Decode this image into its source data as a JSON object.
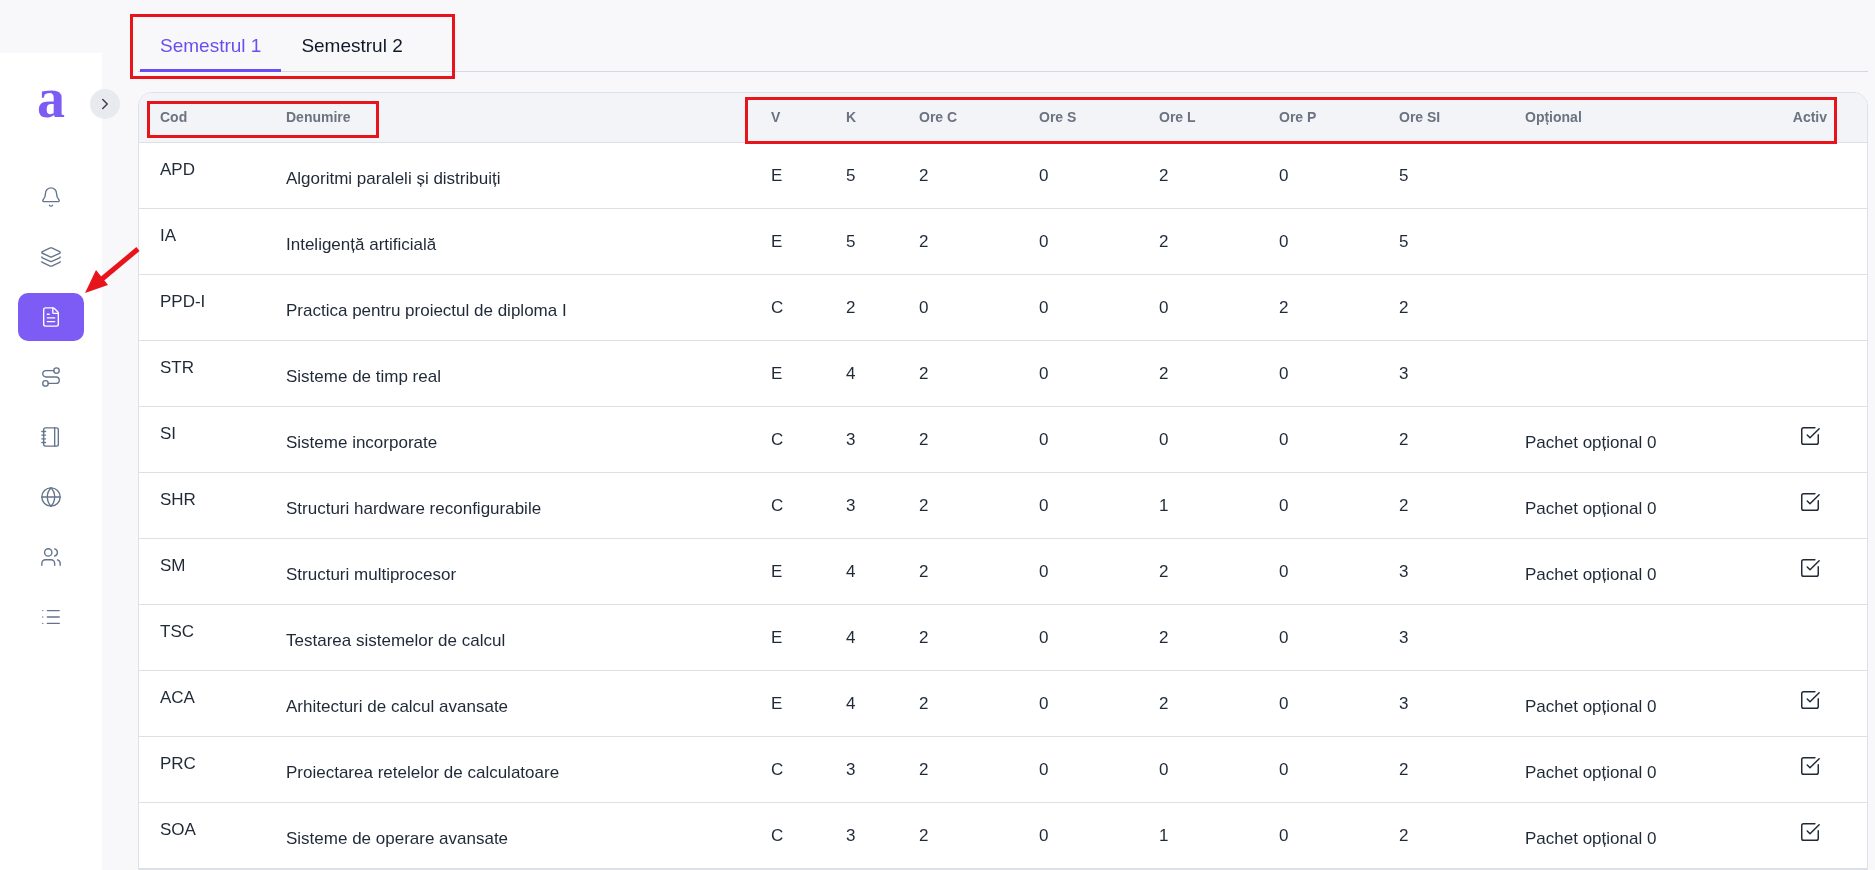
{
  "sidebar": {
    "logo": "a",
    "nav_items": [
      {
        "selected": false
      },
      {
        "selected": false
      },
      {
        "selected": true
      },
      {
        "selected": false
      },
      {
        "selected": false
      },
      {
        "selected": false
      },
      {
        "selected": false
      },
      {
        "selected": false
      }
    ]
  },
  "tabs": [
    {
      "label": "Semestrul 1",
      "selected": true
    },
    {
      "label": "Semestrul 2",
      "selected": false
    }
  ],
  "table": {
    "columns": [
      "Cod",
      "Denumire",
      "V",
      "K",
      "Ore C",
      "Ore S",
      "Ore L",
      "Ore P",
      "Ore SI",
      "Opțional",
      "Activ"
    ],
    "rows": [
      {
        "code": "APD",
        "name": "Algoritmi paraleli și distribuiți",
        "v": "E",
        "k": "5",
        "ore_c": "2",
        "ore_s": "0",
        "ore_l": "2",
        "ore_p": "0",
        "ore_si": "5",
        "active": false
      },
      {
        "code": "IA",
        "name": "Inteligență artificială",
        "v": "E",
        "k": "5",
        "ore_c": "2",
        "ore_s": "0",
        "ore_l": "2",
        "ore_p": "0",
        "ore_si": "5",
        "active": false
      },
      {
        "code": "PPD-I",
        "name": "Practica pentru proiectul de diploma I",
        "v": "C",
        "k": "2",
        "ore_c": "0",
        "ore_s": "0",
        "ore_l": "0",
        "ore_p": "2",
        "ore_si": "2",
        "active": false
      },
      {
        "code": "STR",
        "name": "Sisteme de timp real",
        "v": "E",
        "k": "4",
        "ore_c": "2",
        "ore_s": "0",
        "ore_l": "2",
        "ore_p": "0",
        "ore_si": "3",
        "active": false
      },
      {
        "code": "SI",
        "name": "Sisteme incorporate",
        "v": "C",
        "k": "3",
        "ore_c": "2",
        "ore_s": "0",
        "ore_l": "0",
        "ore_p": "0",
        "ore_si": "2",
        "optional": "Pachet opțional 0",
        "active": true
      },
      {
        "code": "SHR",
        "name": "Structuri hardware reconfigurabile",
        "v": "C",
        "k": "3",
        "ore_c": "2",
        "ore_s": "0",
        "ore_l": "1",
        "ore_p": "0",
        "ore_si": "2",
        "optional": "Pachet opțional 0",
        "active": true
      },
      {
        "code": "SM",
        "name": "Structuri multiprocesor",
        "v": "E",
        "k": "4",
        "ore_c": "2",
        "ore_s": "0",
        "ore_l": "2",
        "ore_p": "0",
        "ore_si": "3",
        "optional": "Pachet opțional 0",
        "active": true
      },
      {
        "code": "TSC",
        "name": "Testarea sistemelor de calcul",
        "v": "E",
        "k": "4",
        "ore_c": "2",
        "ore_s": "0",
        "ore_l": "2",
        "ore_p": "0",
        "ore_si": "3",
        "active": false
      },
      {
        "code": "ACA",
        "name": "Arhitecturi de calcul avansate",
        "v": "E",
        "k": "4",
        "ore_c": "2",
        "ore_s": "0",
        "ore_l": "2",
        "ore_p": "0",
        "ore_si": "3",
        "optional": "Pachet opțional 0",
        "active": true
      },
      {
        "code": "PRC",
        "name": "Proiectarea retelelor de calculatoare",
        "v": "C",
        "k": "3",
        "ore_c": "2",
        "ore_s": "0",
        "ore_l": "0",
        "ore_p": "0",
        "ore_si": "2",
        "optional": "Pachet opțional 0",
        "active": true
      },
      {
        "code": "SOA",
        "name": "Sisteme de operare avansate",
        "v": "C",
        "k": "3",
        "ore_c": "2",
        "ore_s": "0",
        "ore_l": "1",
        "ore_p": "0",
        "ore_si": "2",
        "optional": "Pachet opțional 0",
        "active": true
      }
    ]
  }
}
